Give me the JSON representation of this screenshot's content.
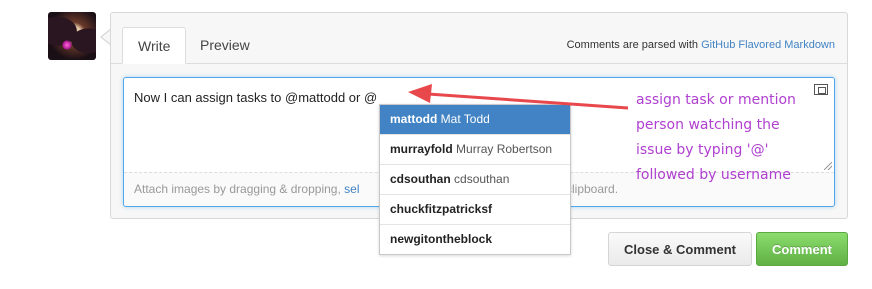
{
  "tabs": {
    "write_label": "Write",
    "preview_label": "Preview"
  },
  "parse_note": {
    "prefix": "Comments are parsed with ",
    "link": "GitHub Flavored Markdown"
  },
  "editor": {
    "value": "Now I can assign tasks to @mattodd or @",
    "attach_prefix": "Attach images by dragging & dropping, ",
    "attach_link": "sel",
    "attach_tail": "clipboard."
  },
  "suggestions": [
    {
      "username": "mattodd",
      "full_name": "Mat Todd",
      "active": true
    },
    {
      "username": "murrayfold",
      "full_name": "Murray Robertson",
      "active": false
    },
    {
      "username": "cdsouthan",
      "full_name": "cdsouthan",
      "active": false
    },
    {
      "username": "chuckfitzpatricksf",
      "full_name": "",
      "active": false
    },
    {
      "username": "newgitontheblock",
      "full_name": "",
      "active": false
    }
  ],
  "buttons": {
    "close_comment": "Close & Comment",
    "comment": "Comment"
  },
  "annotation": {
    "lines": [
      "assign task or mention",
      "person watching the",
      "issue by typing '@'",
      "followed by username"
    ],
    "color": "#b040d0",
    "arrow_color": "#e8474c"
  },
  "colors": {
    "accent": "#4183c4",
    "comment_button": "#6cc644"
  }
}
